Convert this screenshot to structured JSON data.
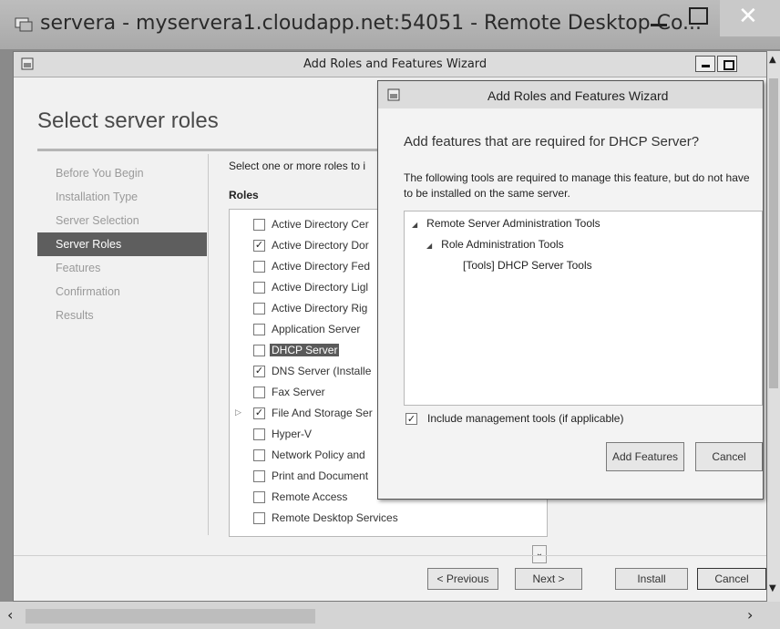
{
  "rdp": {
    "title": "servera - myservera1.cloudapp.net:54051 - Remote Desktop Co...",
    "close_glyph": "✕"
  },
  "wizard": {
    "title": "Add Roles and Features Wizard",
    "page_title": "Select server roles",
    "nav": [
      {
        "label": "Before You Begin"
      },
      {
        "label": "Installation Type"
      },
      {
        "label": "Server Selection"
      },
      {
        "label": "Server Roles"
      },
      {
        "label": "Features"
      },
      {
        "label": "Confirmation"
      },
      {
        "label": "Results"
      }
    ],
    "instructions": "Select one or more roles to i",
    "roles_label": "Roles",
    "roles": [
      {
        "label": "Active Directory Cer",
        "checked": false
      },
      {
        "label": "Active Directory Dor",
        "checked": true
      },
      {
        "label": "Active Directory Fed",
        "checked": false
      },
      {
        "label": "Active Directory Ligl",
        "checked": false
      },
      {
        "label": "Active Directory Rig",
        "checked": false
      },
      {
        "label": "Application Server",
        "checked": false
      },
      {
        "label": "DHCP Server",
        "checked": false
      },
      {
        "label": "DNS Server (Installe",
        "checked": true
      },
      {
        "label": "Fax Server",
        "checked": false
      },
      {
        "label": "File And Storage Ser",
        "checked": true
      },
      {
        "label": "Hyper-V",
        "checked": false
      },
      {
        "label": "Network Policy and",
        "checked": false
      },
      {
        "label": "Print and Document",
        "checked": false
      },
      {
        "label": "Remote Access",
        "checked": false
      },
      {
        "label": "Remote Desktop Services",
        "checked": false
      }
    ],
    "check_glyph": "✓",
    "buttons": {
      "previous": "< Previous",
      "next": "Next >",
      "install": "Install",
      "cancel": "Cancel"
    }
  },
  "dialog": {
    "title": "Add Roles and Features Wizard",
    "heading": "Add features that are required for DHCP Server?",
    "description": "The following tools are required to manage this feature, but do not have to be installed on the same server.",
    "tree": {
      "root": "Remote Server Administration Tools",
      "child": "Role Administration Tools",
      "leaf": "[Tools] DHCP Server Tools"
    },
    "include_tools_label": "Include management tools (if applicable)",
    "include_tools_checked": true,
    "buttons": {
      "add": "Add Features",
      "cancel": "Cancel"
    }
  }
}
